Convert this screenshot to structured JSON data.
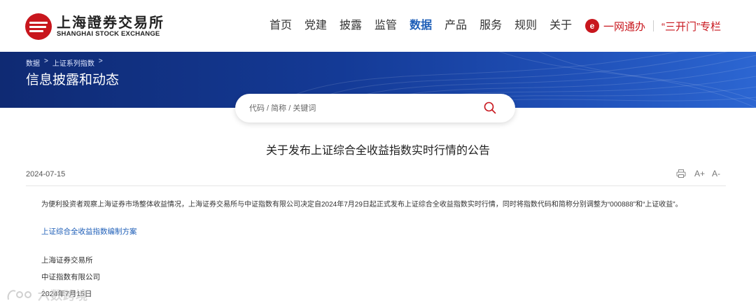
{
  "header": {
    "logo_cn": "上海證券交易所",
    "logo_en": "SHANGHAI STOCK EXCHANGE",
    "nav": [
      "首页",
      "党建",
      "披露",
      "监管",
      "数据",
      "产品",
      "服务",
      "规则",
      "关于"
    ],
    "nav_active": "数据",
    "quick_links": [
      "一网通办",
      "“三开门”专栏"
    ]
  },
  "banner": {
    "breadcrumbs": [
      "数据",
      "上证系列指数"
    ],
    "title": "信息披露和动态"
  },
  "search": {
    "placeholder": "代码 / 简称 / 关键词"
  },
  "article": {
    "title": "关于发布上证综合全收益指数实时行情的公告",
    "date": "2024-07-15",
    "tools": [
      "print-icon",
      "A+",
      "A-"
    ],
    "body": "为便利投资者观察上海证券市场整体收益情况，上海证券交易所与中证指数有限公司决定自2024年7月29日起正式发布上证综合全收益指数实时行情，同时将指数代码和简称分别调整为“000888”和“上证收益”。",
    "attachment": "上证综合全收益指数编制方案",
    "signature": [
      "上海证券交易所",
      "中证指数有限公司",
      "2024年7月15日"
    ]
  },
  "watermark": "六数跨境",
  "colors": {
    "brand_red": "#c8161d",
    "link_blue": "#1f5fb8",
    "banner_blue": "#143a96"
  }
}
